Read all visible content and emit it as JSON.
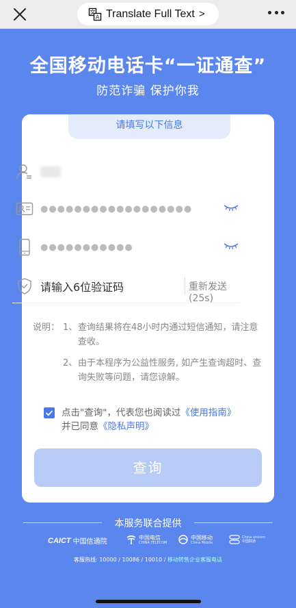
{
  "topbar": {
    "translate_label": "Translate Full Text",
    "translate_chevron": ">",
    "close_icon": "close-icon",
    "more_icon": "more-icon"
  },
  "header": {
    "title": "全国移动电话卡“一证通查”",
    "subtitle": "防范诈骗 保护你我"
  },
  "form": {
    "section_label": "请填写以下信息",
    "name_value": "",
    "id_masked": "●●●●●●●●●●●●●●●●●●",
    "phone_masked": "●●●●●●●●●●●",
    "code_placeholder": "请输入6位验证码",
    "resend_label": "重新发送(25s)"
  },
  "notes": {
    "label": "说明：",
    "item1_num": "1、",
    "item1_text": "查询结果将在48小时内通过短信通知，请注意查收。",
    "item2_num": "2、",
    "item2_text": "由于本程序为公益性服务, 如产生查询超时、查询失败等问题，请您谅解。"
  },
  "agreement": {
    "checked": true,
    "text_before": "点击\"查询\"，代表您也阅读过",
    "guide_link": "《使用指南》",
    "text_mid": "并已同意",
    "privacy_link": "《隐私声明》"
  },
  "query_button": "查询",
  "footer": {
    "provider_label": "本服务联合提供",
    "logos": {
      "caict_abbr": "CAICT",
      "caict_name": "中国信通院",
      "telecom_name": "中国电信",
      "telecom_en": "CHINA TELECOM",
      "mobile_name": "中国移动",
      "mobile_en": "China Mobile",
      "unicom_en": "China unicom",
      "unicom_cn": "中国联通"
    },
    "hotline_prefix": "客服热线: 10000 / 10086 / 10010 /",
    "hotline_link": "移动转售企业客服电话"
  },
  "colors": {
    "background": "#5b86ee",
    "accent": "#4a78e6",
    "button_disabled": "#b7cbf6"
  }
}
